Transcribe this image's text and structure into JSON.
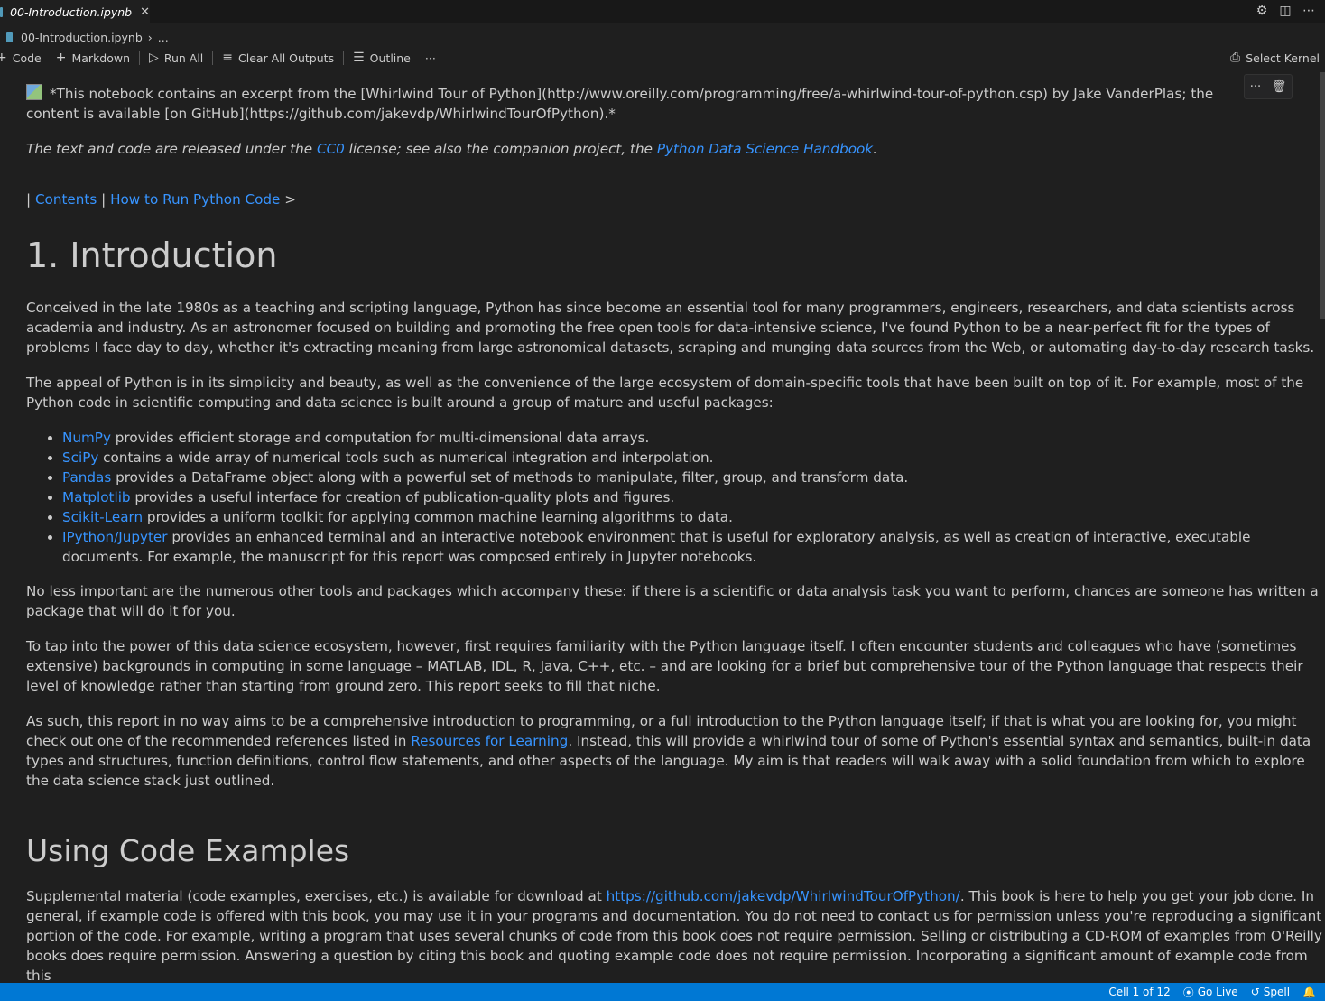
{
  "tab": {
    "title": "00-Introduction.ipynb",
    "close": "✕"
  },
  "breadcrumb": {
    "file": "00-Introduction.ipynb",
    "more": "..."
  },
  "toolbar": {
    "code_label": "Code",
    "markdown_label": "Markdown",
    "run_all_label": "Run All",
    "clear_outputs_label": "Clear All Outputs",
    "outline_label": "Outline",
    "more_label": "···",
    "kernel_label": "Select Kernel"
  },
  "cell_toolbar": {
    "more": "···",
    "delete": "🗑"
  },
  "content": {
    "intro_note": "*This notebook contains an excerpt from the [Whirlwind Tour of Python](http://www.oreilly.com/programming/free/a-whirlwind-tour-of-python.csp) by Jake VanderPlas; the content is available [on GitHub](https://github.com/jakevdp/WhirlwindTourOfPython).*",
    "license_pre": "The text and code are released under the ",
    "license_link": "CC0",
    "license_mid": " license; see also the companion project, the ",
    "license_link2": "Python Data Science Handbook",
    "license_post": ".",
    "nav_pipe": "| ",
    "nav_contents": "Contents",
    "nav_sep": " | ",
    "nav_next": "How to Run Python Code",
    "nav_arrow": " >",
    "heading1": "1. Introduction",
    "para1": "Conceived in the late 1980s as a teaching and scripting language, Python has since become an essential tool for many programmers, engineers, researchers, and data scientists across academia and industry. As an astronomer focused on building and promoting the free open tools for data-intensive science, I've found Python to be a near-perfect fit for the types of problems I face day to day, whether it's extracting meaning from large astronomical datasets, scraping and munging data sources from the Web, or automating day-to-day research tasks.",
    "para2": "The appeal of Python is in its simplicity and beauty, as well as the convenience of the large ecosystem of domain-specific tools that have been built on top of it. For example, most of the Python code in scientific computing and data science is built around a group of mature and useful packages:",
    "packages": [
      {
        "name": "NumPy",
        "desc": " provides efficient storage and computation for multi-dimensional data arrays."
      },
      {
        "name": "SciPy",
        "desc": " contains a wide array of numerical tools such as numerical integration and interpolation."
      },
      {
        "name": "Pandas",
        "desc": " provides a DataFrame object along with a powerful set of methods to manipulate, filter, group, and transform data."
      },
      {
        "name": "Matplotlib",
        "desc": " provides a useful interface for creation of publication-quality plots and figures."
      },
      {
        "name": "Scikit-Learn",
        "desc": " provides a uniform toolkit for applying common machine learning algorithms to data."
      },
      {
        "name": "IPython/Jupyter",
        "desc": " provides an enhanced terminal and an interactive notebook environment that is useful for exploratory analysis, as well as creation of interactive, executable documents. For example, the manuscript for this report was composed entirely in Jupyter notebooks."
      }
    ],
    "para3": "No less important are the numerous other tools and packages which accompany these: if there is a scientific or data analysis task you want to perform, chances are someone has written a package that will do it for you.",
    "para4": "To tap into the power of this data science ecosystem, however, first requires familiarity with the Python language itself. I often encounter students and colleagues who have (sometimes extensive) backgrounds in computing in some language – MATLAB, IDL, R, Java, C++, etc. – and are looking for a brief but comprehensive tour of the Python language that respects their level of knowledge rather than starting from ground zero. This report seeks to fill that niche.",
    "para5_pre": "As such, this report in no way aims to be a comprehensive introduction to programming, or a full introduction to the Python language itself; if that is what you are looking for, you might check out one of the recommended references listed in ",
    "para5_link": "Resources for Learning",
    "para5_post": ". Instead, this will provide a whirlwind tour of some of Python's essential syntax and semantics, built-in data types and structures, function definitions, control flow statements, and other aspects of the language. My aim is that readers will walk away with a solid foundation from which to explore the data science stack just outlined.",
    "heading2": "Using Code Examples",
    "para6_pre": "Supplemental material (code examples, exercises, etc.) is available for download at ",
    "para6_link": "https://github.com/jakevdp/WhirlwindTourOfPython/",
    "para6_post": ". This book is here to help you get your job done. In general, if example code is offered with this book, you may use it in your programs and documentation. You do not need to contact us for permission unless you're reproducing a significant portion of the code. For example, writing a program that uses several chunks of code from this book does not require permission. Selling or distributing a CD-ROM of examples from O'Reilly books does require permission. Answering a question by citing this book and quoting example code does not require permission. Incorporating a significant amount of example code from this"
  },
  "statusbar": {
    "cell_position": "Cell 1 of 12",
    "go_live": "Go Live",
    "spell": "Spell"
  },
  "colors": {
    "link": "#3794ff",
    "statusbar": "#0078d4",
    "background": "#1f1f1f"
  }
}
